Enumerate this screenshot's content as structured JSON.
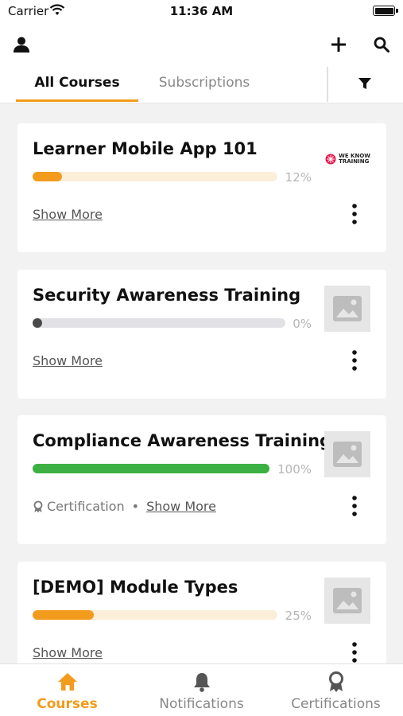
{
  "status_bar": {
    "carrier": "Carrier",
    "time": "11:36 AM"
  },
  "header": {
    "tabs": [
      {
        "label": "All Courses",
        "active": true
      },
      {
        "label": "Subscriptions",
        "active": false
      }
    ]
  },
  "courses": [
    {
      "title": "Learner Mobile App 101",
      "progress_percent": 12,
      "progress_label": "12%",
      "show_more": "Show More",
      "thumbnail": "we-know-training-logo",
      "brand": "WE KNOW\nTRAINING",
      "bar_color": "#f29b1c",
      "track_color": "#fbefd9"
    },
    {
      "title": "Security Awareness Training",
      "progress_percent": 0,
      "progress_label": "0%",
      "show_more": "Show More",
      "thumbnail": "image-placeholder-icon",
      "bar_color": "#4a4a4a",
      "track_color": "#e2e2e6"
    },
    {
      "title": "Compliance Awareness Training",
      "progress_percent": 100,
      "progress_label": "100%",
      "certification": "Certification",
      "separator": "•",
      "show_more": "Show More",
      "thumbnail": "image-placeholder-icon",
      "bar_color": "#3cb043",
      "track_color": "#e2e2e6"
    },
    {
      "title": "[DEMO] Module Types",
      "progress_percent": 25,
      "progress_label": "25%",
      "show_more": "Show More",
      "thumbnail": "image-placeholder-icon",
      "bar_color": "#f29b1c",
      "track_color": "#fbefd9"
    }
  ],
  "bottom_nav": [
    {
      "label": "Courses",
      "icon": "home-icon",
      "active": true
    },
    {
      "label": "Notifications",
      "icon": "bell-icon",
      "active": false
    },
    {
      "label": "Certifications",
      "icon": "award-icon",
      "active": false
    }
  ],
  "colors": {
    "accent": "#f29b1c",
    "success": "#3cb043"
  }
}
